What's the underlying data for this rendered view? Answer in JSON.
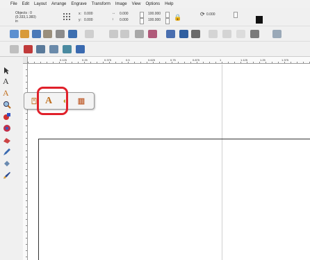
{
  "menu": [
    "File",
    "Edit",
    "Layout",
    "Arrange",
    "Engrave",
    "Transform",
    "Image",
    "View",
    "Options",
    "Help"
  ],
  "properties": {
    "objects_line1": "Objects : 0",
    "objects_line2": "(0.333,1.383)",
    "objects_line3": "in",
    "x_label": "x:",
    "x_value": "0.000",
    "y_label": "y:",
    "y_value": "0.000",
    "w_value": "0.000",
    "h_value": "0.000",
    "w_pct": "100.000",
    "h_pct": "100.000",
    "rotate_value": "0.000"
  },
  "ruler_labels": [
    "0.125",
    "0.25",
    "0.375",
    "0.5",
    "0.625",
    "0.75",
    "0.875",
    "1",
    "1.125",
    "1.25",
    "1.375"
  ],
  "colors": {
    "highlight": "#e0202a",
    "fill_swatch": "#111111"
  },
  "flyout_icons": [
    "artistic-text-icon",
    "text-icon",
    "text-on-path-icon",
    "vertical-text-icon"
  ]
}
